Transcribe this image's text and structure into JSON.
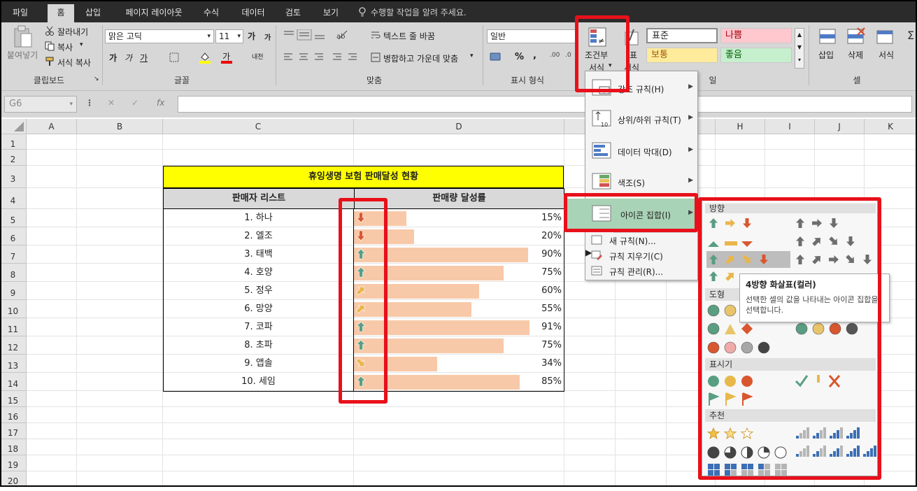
{
  "menu": {
    "tabs": [
      "파일",
      "홈",
      "삽입",
      "페이지 레이아웃",
      "수식",
      "데이터",
      "검토",
      "보기"
    ],
    "active_tab": "홈",
    "tell_me": "수행할 작업을 알려 주세요."
  },
  "ribbon": {
    "clipboard": {
      "paste": "붙여넣기",
      "cut": "잘라내기",
      "copy": "복사",
      "format_painter": "서식 복사",
      "label": "클립보드"
    },
    "font": {
      "name": "맑은 고딕",
      "size": "11",
      "grow": "가",
      "shrink": "가",
      "bold": "가",
      "italic": "가",
      "underline": "가",
      "color_letter": "가",
      "phonetic": "내천",
      "label": "글꼴"
    },
    "alignment": {
      "wrap": "텍스트 줄 바꿈",
      "merge": "병합하고 가운데 맞춤",
      "label": "맞춤"
    },
    "number": {
      "format": "일반",
      "percent": "%",
      "label": "표시 형식"
    },
    "styles": {
      "cond_format": "조건부\n서식",
      "cond_line1": "조건부",
      "cond_line2": "서식",
      "table_frag": "표",
      "table_frag2": "서식",
      "normal": "표준",
      "bad": "나쁨",
      "neutral": "보통",
      "good": "좋음",
      "label_frag": "일"
    },
    "cells": {
      "insert": "삽입",
      "delete": "삭제",
      "format": "서식",
      "label": "셀"
    }
  },
  "formula_bar": {
    "name_box": "G6",
    "fx": "fx"
  },
  "columns": [
    "A",
    "B",
    "C",
    "D",
    "E",
    "F",
    "G",
    "H",
    "I",
    "J",
    "K"
  ],
  "rows": [
    "1",
    "2",
    "3",
    "4",
    "5",
    "6",
    "7",
    "8",
    "9",
    "10",
    "11",
    "12",
    "13",
    "14",
    "15",
    "16",
    "17",
    "18",
    "19",
    "20"
  ],
  "sheet": {
    "title": "휴잉생명 보험 판매달성 현황",
    "header_name": "판매자 리스트",
    "header_value": "판매량 달성률",
    "records": [
      {
        "name": "1. 하나",
        "pct": "15%",
        "value": 0.15,
        "arrow": "down"
      },
      {
        "name": "2. 엘조",
        "pct": "20%",
        "value": 0.2,
        "arrow": "down"
      },
      {
        "name": "3. 태백",
        "pct": "90%",
        "value": 0.9,
        "arrow": "up"
      },
      {
        "name": "4. 호양",
        "pct": "75%",
        "value": 0.75,
        "arrow": "up"
      },
      {
        "name": "5. 정우",
        "pct": "60%",
        "value": 0.6,
        "arrow": "up-right"
      },
      {
        "name": "6. 망양",
        "pct": "55%",
        "value": 0.55,
        "arrow": "up-right"
      },
      {
        "name": "7. 코파",
        "pct": "91%",
        "value": 0.91,
        "arrow": "up"
      },
      {
        "name": "8. 초파",
        "pct": "75%",
        "value": 0.75,
        "arrow": "up"
      },
      {
        "name": "9. 앱솔",
        "pct": "34%",
        "value": 0.34,
        "arrow": "down-right"
      },
      {
        "name": "10. 세임",
        "pct": "85%",
        "value": 0.85,
        "arrow": "up"
      }
    ]
  },
  "cond_menu": {
    "items": [
      {
        "label": "강조 규칙(H)",
        "icon": "highlight-rules-icon"
      },
      {
        "label": "상위/하위 규칙(T)",
        "icon": "top-bottom-icon"
      },
      {
        "label": "데이터 막대(D)",
        "icon": "data-bar-icon"
      },
      {
        "label": "색조(S)",
        "icon": "color-scale-icon"
      },
      {
        "label": "아이콘 집합(I)",
        "icon": "icon-sets-icon"
      }
    ],
    "new_rule": "새 규칙(N)...",
    "clear_rules": "규칙 지우기(C)",
    "manage_rules": "규칙 관리(R)..."
  },
  "icon_sets": {
    "sections": [
      "방향",
      "도형",
      "표시기",
      "추천"
    ],
    "tooltip_title": "4방향 화살표(컬러)",
    "tooltip_desc": "선택한 셀의 값을 나타내는 아이콘 집합을 선택합니다."
  },
  "colors": {
    "accent_red": "#e8101a",
    "bar_fill": "#f8c9a8",
    "title_fill": "#ffff00",
    "arrow_green": "#5a9e82",
    "arrow_yellow": "#eab54a",
    "arrow_red": "#d9572f",
    "menu_highlight": "#a9d3b6"
  }
}
